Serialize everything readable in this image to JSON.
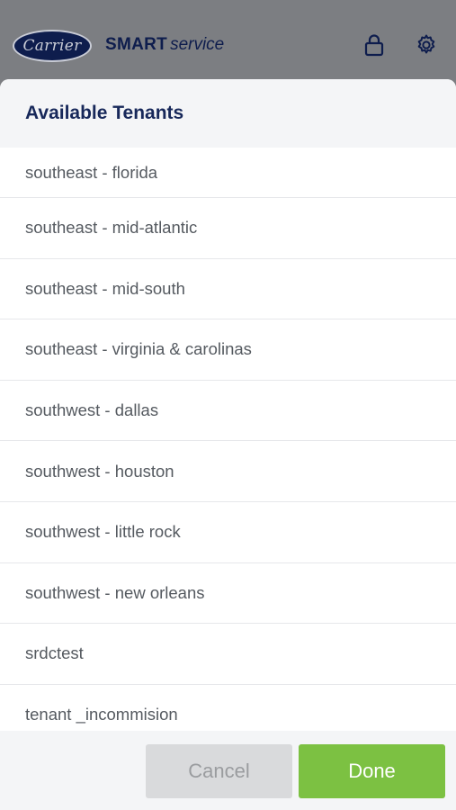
{
  "header": {
    "logo_text": "Carrier",
    "brand_bold": "SMART",
    "brand_italic": "service",
    "icons": [
      "lock-icon",
      "gear-icon"
    ]
  },
  "sheet": {
    "title": "Available Tenants",
    "tenants": [
      "southeast - florida",
      "southeast - mid-atlantic",
      "southeast - mid-south",
      "southeast - virginia & carolinas",
      "southwest - dallas",
      "southwest - houston",
      "southwest - little rock",
      "southwest - new orleans",
      "srdctest",
      "tenant _incommision"
    ]
  },
  "footer": {
    "cancel_label": "Cancel",
    "done_label": "Done"
  },
  "colors": {
    "brand_navy": "#17285a",
    "done_green": "#7cc142",
    "cancel_gray": "#d9dadc"
  }
}
